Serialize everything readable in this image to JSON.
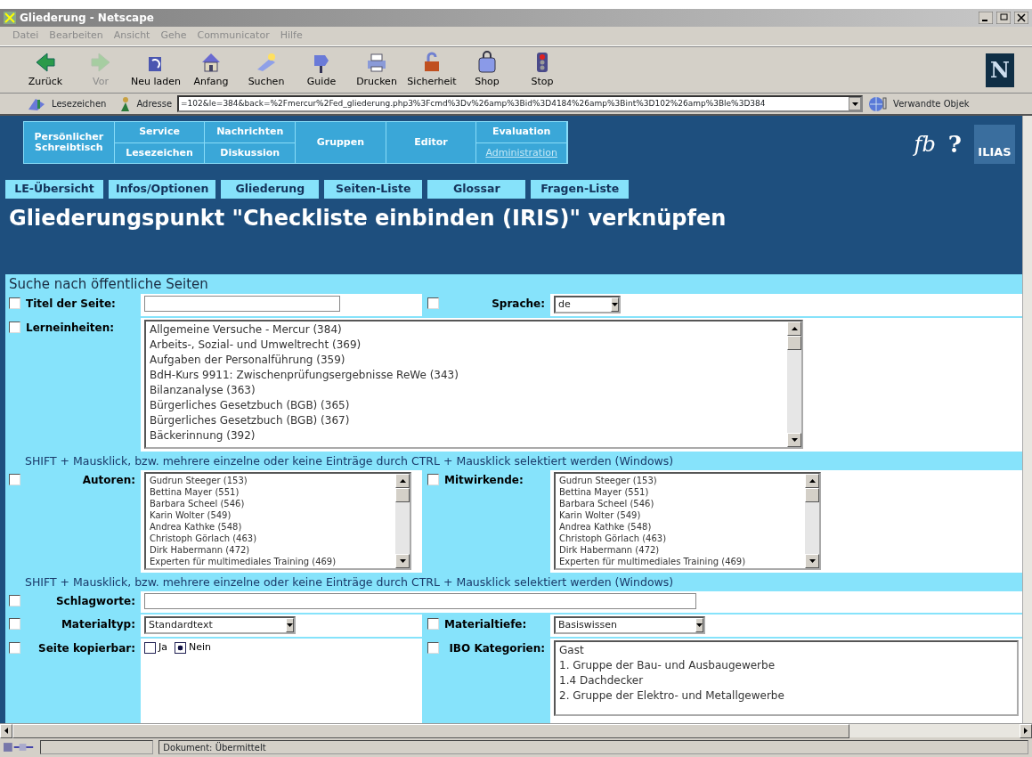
{
  "window": {
    "title": "Gliederung - Netscape"
  },
  "menu": [
    {
      "label": "Datei"
    },
    {
      "label": "Bearbeiten"
    },
    {
      "label": "Ansicht"
    },
    {
      "label": "Gehe"
    },
    {
      "label": "Communicator"
    },
    {
      "label": "Hilfe"
    }
  ],
  "toolbar": [
    {
      "label": "Zurück",
      "disabled": false
    },
    {
      "label": "Vor",
      "disabled": true
    },
    {
      "label": "Neu laden",
      "disabled": false
    },
    {
      "label": "Anfang",
      "disabled": false
    },
    {
      "label": "Suchen",
      "disabled": false
    },
    {
      "label": "Guide",
      "disabled": false
    },
    {
      "label": "Drucken",
      "disabled": false
    },
    {
      "label": "Sicherheit",
      "disabled": false
    },
    {
      "label": "Shop",
      "disabled": false
    },
    {
      "label": "Stop",
      "disabled": false
    }
  ],
  "brand_logo": "N",
  "location_bar": {
    "bookmarks": "Lesezeichen",
    "address_label": "Adresse",
    "address": "=102&le=384&back=%2Fmercur%2Fed_gliederung.php3%3Fcmd%3Dv%26amp%3Bid%3D4184%26amp%3Bint%3D102%26amp%3Ble%3D384",
    "related": "Verwandte Objek"
  },
  "nav": [
    {
      "top": "Persönlicher Schreibtisch"
    },
    {
      "top": "Service",
      "bottom": "Lesezeichen"
    },
    {
      "top": "Nachrichten",
      "bottom": "Diskussion"
    },
    {
      "top": "Gruppen"
    },
    {
      "top": "Editor"
    },
    {
      "top": "Evaluation",
      "bottom": "Administration",
      "bottom_disabled": true
    }
  ],
  "header_icons": {
    "fb": "fb",
    "help": "?",
    "logo": "ILIAS"
  },
  "tabs": [
    {
      "label": "LE-Übersicht"
    },
    {
      "label": "Infos/Optionen"
    },
    {
      "label": "Gliederung"
    },
    {
      "label": "Seiten-Liste"
    },
    {
      "label": "Glossar"
    },
    {
      "label": "Fragen-Liste"
    }
  ],
  "heading": "Gliederungspunkt \"Checkliste einbinden (IRIS)\" verknüpfen",
  "form": {
    "title": "Suche nach öffentliche Seiten",
    "page_title": {
      "label": "Titel der Seite:",
      "checked": false
    },
    "language": {
      "label": "Sprache:",
      "checked": false,
      "value": "de"
    },
    "units": {
      "label": "Lerneinheiten:",
      "checked": false,
      "options": [
        "Allgemeine Versuche - Mercur (384)",
        "Arbeits-, Sozial- und Umweltrecht (369)",
        "Aufgaben der Personalführung (359)",
        "BdH-Kurs 9911: Zwischenprüfungsergebnisse ReWe (343)",
        "Bilanzanalyse (363)",
        "Bürgerliches Gesetzbuch (BGB) (365)",
        "Bürgerliches Gesetzbuch (BGB) (367)",
        "Bäckerinnung (392)"
      ]
    },
    "hint_1": "SHIFT + Mausklick, bzw. mehrere einzelne oder keine Einträge durch CTRL + Mausklick selektiert werden (Windows)",
    "authors": {
      "label": "Autoren:",
      "checked": false,
      "options": [
        "Gudrun Steeger (153)",
        "Bettina Mayer (551)",
        "Barbara Scheel (546)",
        "Karin Wolter (549)",
        "Andrea Kathke (548)",
        "Christoph Görlach (463)",
        "Dirk Habermann (472)",
        "Experten für multimediales Training (469)"
      ]
    },
    "contributors": {
      "label": "Mitwirkende:",
      "checked": false,
      "options": [
        "Gudrun Steeger (153)",
        "Bettina Mayer (551)",
        "Barbara Scheel (546)",
        "Karin Wolter (549)",
        "Andrea Kathke (548)",
        "Christoph Görlach (463)",
        "Dirk Habermann (472)",
        "Experten für multimediales Training (469)"
      ]
    },
    "hint_2": "SHIFT + Mausklick, bzw. mehrere einzelne oder keine Einträge durch CTRL + Mausklick selektiert werden (Windows)",
    "keywords": {
      "label": "Schlagworte:",
      "checked": false
    },
    "material_type": {
      "label": "Materialtyp:",
      "checked": false,
      "value": "Standardtext"
    },
    "material_depth": {
      "label": "Materialtiefe:",
      "checked": false,
      "value": "Basiswissen"
    },
    "copyable": {
      "label": "Seite kopierbar:",
      "checked": false,
      "options": [
        {
          "label": "Ja",
          "selected": false
        },
        {
          "label": "Nein",
          "selected": true
        }
      ]
    },
    "categories": {
      "label": "IBO Kategorien:",
      "checked": false,
      "options": [
        "Gast",
        "1. Gruppe der Bau- und Ausbaugewerbe",
        "1.4 Dachdecker",
        "2. Gruppe der Elektro- und Metallgewerbe"
      ]
    }
  },
  "status_bar": {
    "text": "Dokument: Übermittelt"
  }
}
